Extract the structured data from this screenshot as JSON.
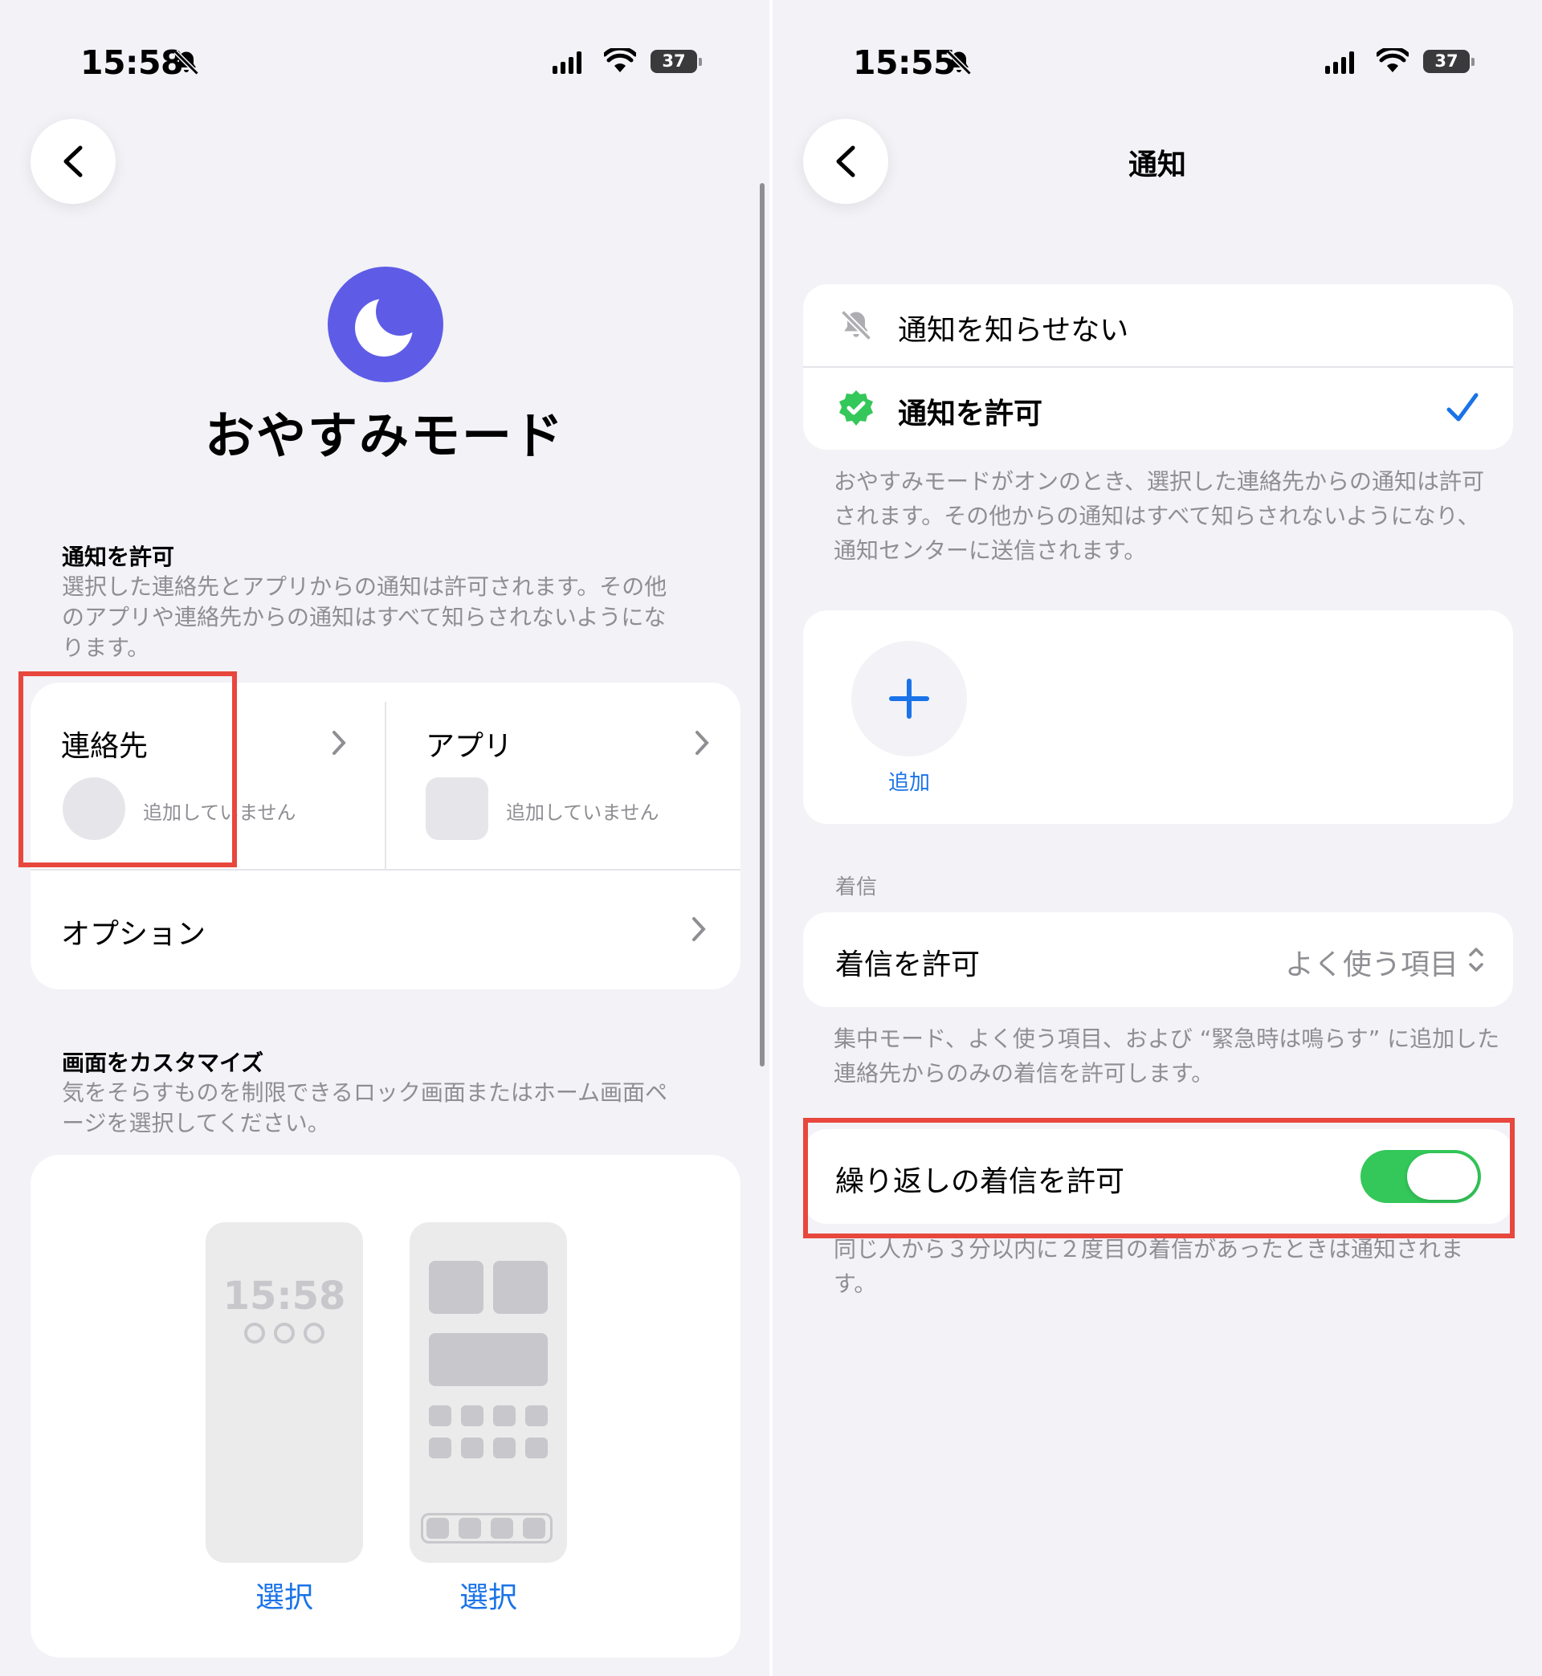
{
  "left": {
    "status": {
      "time": "15:58",
      "battery": "37"
    },
    "mode_title": "おやすみモード",
    "allow_section": {
      "header": "通知を許可",
      "description": "選択した連絡先とアプリからの通知は許可されます。その他のアプリや連絡先からの通知はすべて知らされないようになります。"
    },
    "contacts": {
      "label": "連絡先",
      "status": "追加していません"
    },
    "apps": {
      "label": "アプリ",
      "status": "追加していません"
    },
    "options": {
      "label": "オプション"
    },
    "customize": {
      "header": "画面をカスタマイズ",
      "description": "気をそらすものを制限できるロック画面またはホーム画面ページを選択してください。",
      "lock_preview_time": "15:58",
      "lock_select": "選択",
      "home_select": "選択"
    }
  },
  "right": {
    "status": {
      "time": "15:55",
      "battery": "37"
    },
    "nav_title": "通知",
    "options": [
      {
        "label": "通知を知らせない",
        "icon": "bell-slash-icon",
        "selected": false
      },
      {
        "label": "通知を許可",
        "icon": "verified-badge-icon",
        "selected": true
      }
    ],
    "allow_description": "おやすみモードがオンのとき、選択した連絡先からの通知は許可されます。その他からの通知はすべて知らされないようになり、通知センターに送信されます。",
    "add_label": "追加",
    "calls_section": {
      "header": "着信",
      "allow_calls_label": "着信を許可",
      "allow_calls_value": "よく使う項目",
      "allow_calls_description": "集中モード、よく使う項目、および “緊急時は鳴らす” に追加した連絡先からのみの着信を許可します。",
      "repeated_calls_label": "繰り返しの着信を許可",
      "repeated_calls_enabled": true,
      "repeated_calls_description": "同じ人から３分以内に２度目の着信があったときは通知されます。"
    }
  },
  "colors": {
    "accent_blue": "#1a73e8",
    "moon_purple": "#5e5ce6",
    "toggle_green": "#34c759",
    "highlight_red": "#e8473d"
  }
}
